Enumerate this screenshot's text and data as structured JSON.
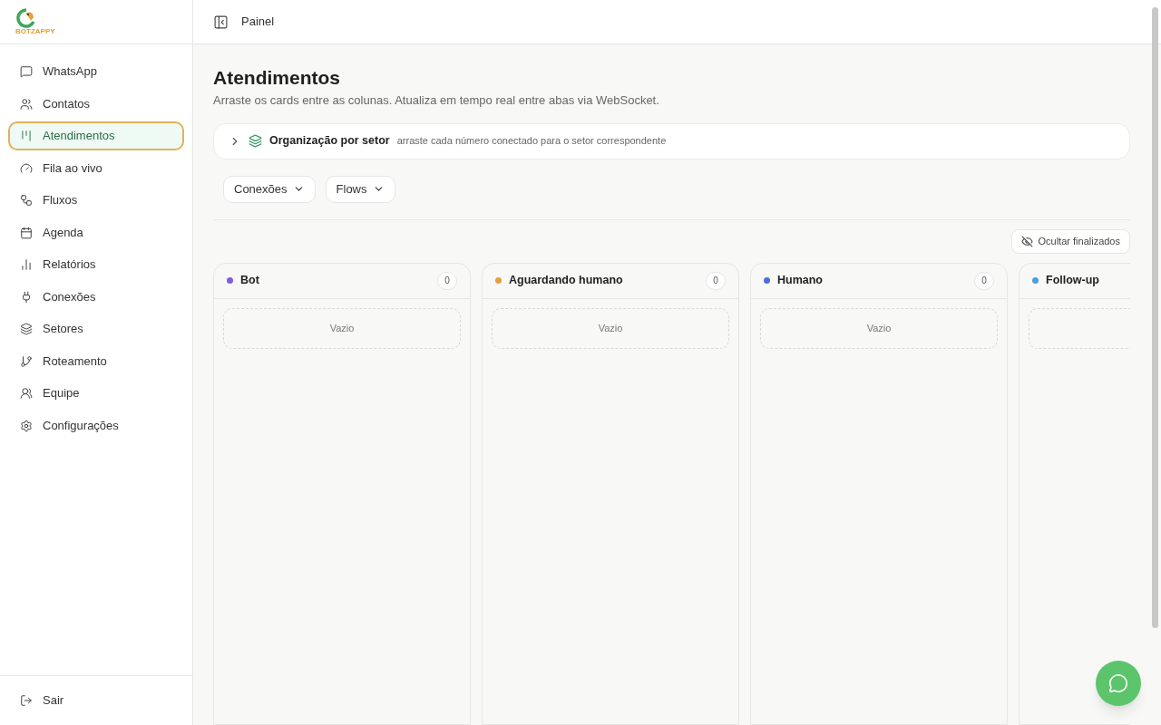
{
  "logo": {
    "text": "BOTZAPPY"
  },
  "sidebar": {
    "items": [
      {
        "label": "WhatsApp",
        "selected": false
      },
      {
        "label": "Contatos",
        "selected": false
      },
      {
        "label": "Atendimentos",
        "selected": true
      },
      {
        "label": "Fila ao vivo",
        "selected": false
      },
      {
        "label": "Fluxos",
        "selected": false
      },
      {
        "label": "Agenda",
        "selected": false
      },
      {
        "label": "Relatórios",
        "selected": false
      },
      {
        "label": "Conexões",
        "selected": false
      },
      {
        "label": "Setores",
        "selected": false
      },
      {
        "label": "Roteamento",
        "selected": false
      },
      {
        "label": "Equipe",
        "selected": false
      },
      {
        "label": "Configurações",
        "selected": false
      }
    ],
    "logout": "Sair"
  },
  "topbar": {
    "title": "Painel"
  },
  "page": {
    "title": "Atendimentos",
    "subtitle": "Arraste os cards entre as colunas. Atualiza em tempo real entre abas via WebSocket."
  },
  "sector_panel": {
    "title": "Organização por setor",
    "hint": "arraste cada número conectado para o setor correspondente",
    "expanded": false
  },
  "filters": [
    "Conexões",
    "Flows"
  ],
  "hide_finished": "Ocultar finalizados",
  "columns": [
    {
      "title": "Bot",
      "color": "#7c5ce0",
      "count": "0",
      "empty": "Vazio"
    },
    {
      "title": "Aguardando humano",
      "color": "#e2a03f",
      "count": "0",
      "empty": "Vazio"
    },
    {
      "title": "Humano",
      "color": "#4a6fdc",
      "count": "0",
      "empty": "Vazio"
    },
    {
      "title": "Follow-up",
      "color": "#4a9fdc"
    }
  ]
}
